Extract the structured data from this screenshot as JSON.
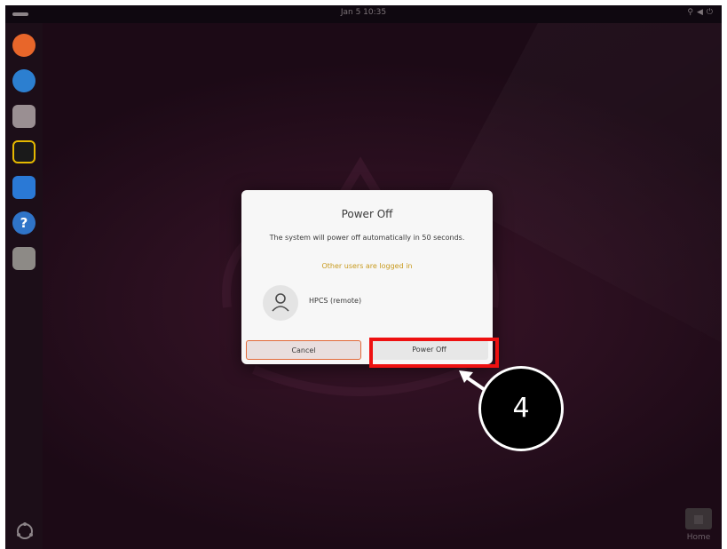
{
  "topbar": {
    "clock": "Jan 5  10:35",
    "tray_icons": [
      "network-icon",
      "volume-icon",
      "power-icon"
    ]
  },
  "dock": {
    "apps": [
      {
        "name": "firefox-icon",
        "color": "#e8662a"
      },
      {
        "name": "thunderbird-icon",
        "color": "#2c7fd0"
      },
      {
        "name": "files-icon",
        "color": "#9a8f92"
      },
      {
        "name": "rhythmbox-icon",
        "color": "#e5b800"
      },
      {
        "name": "writer-icon",
        "color": "#2a79d6"
      },
      {
        "name": "help-icon",
        "color": "#2f74c8"
      },
      {
        "name": "trash-icon",
        "color": "#8d8a86"
      }
    ],
    "help_glyph": "?"
  },
  "desktop": {
    "home_label": "Home"
  },
  "dialog": {
    "title": "Power Off",
    "message": "The system will power off automatically in 50 seconds.",
    "warning": "Other users are logged in",
    "warning_color": "#c89a1e",
    "user": "HPCS (remote)",
    "cancel_label": "Cancel",
    "power_off_label": "Power Off"
  },
  "annotation": {
    "step_number": "4",
    "highlight_color": "#ee1111"
  }
}
